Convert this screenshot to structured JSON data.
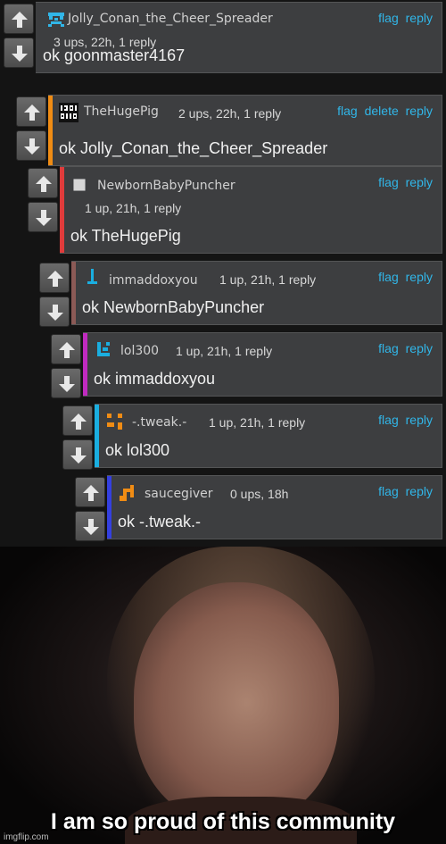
{
  "comments": [
    {
      "username": "Jolly_Conan_the_Cheer_Spreader",
      "meta": "3 ups, 22h, 1 reply",
      "actions": [
        "flag",
        "reply"
      ],
      "text": "ok goonmaster4167",
      "bar_color": "",
      "avatar": "pixel-face-avatar"
    },
    {
      "username": "TheHugePig",
      "meta": "2 ups, 22h, 1 reply",
      "actions": [
        "flag",
        "delete",
        "reply"
      ],
      "text": "ok Jolly_Conan_the_Cheer_Spreader",
      "bar_color": "#f08c14",
      "avatar": "binary-avatar"
    },
    {
      "username": "NewbornBabyPuncher",
      "meta": "1 up, 21h, 1 reply",
      "actions": [
        "flag",
        "reply"
      ],
      "text": "ok TheHugePig",
      "bar_color": "#e03b3b",
      "avatar": "square-avatar"
    },
    {
      "username": "immaddoxyou",
      "meta": "1 up, 21h, 1 reply",
      "actions": [
        "flag",
        "reply"
      ],
      "text": "ok NewbornBabyPuncher",
      "bar_color": "#8b5a56",
      "avatar": "sword-avatar"
    },
    {
      "username": "lol300",
      "meta": "1 up, 21h, 1 reply",
      "actions": [
        "flag",
        "reply"
      ],
      "text": "ok immaddoxyou",
      "bar_color": "#c02ac0",
      "avatar": "pixel-avatar"
    },
    {
      "username": "-.tweak.-",
      "meta": "1 up, 21h, 1 reply",
      "actions": [
        "flag",
        "reply"
      ],
      "text": "ok lol300",
      "bar_color": "#1aaee0",
      "avatar": "orange-blocks-avatar"
    },
    {
      "username": "saucegiver",
      "meta": "0 ups, 18h",
      "actions": [
        "flag",
        "reply"
      ],
      "text": "ok -.tweak.-",
      "bar_color": "#3440e0",
      "avatar": "orange-stairs-avatar"
    }
  ],
  "meme": {
    "caption": "I am so proud of this community",
    "watermark": "imgflip.com"
  },
  "colors": {
    "accent_link": "#31b6e8",
    "panel": "#3d3e40"
  }
}
